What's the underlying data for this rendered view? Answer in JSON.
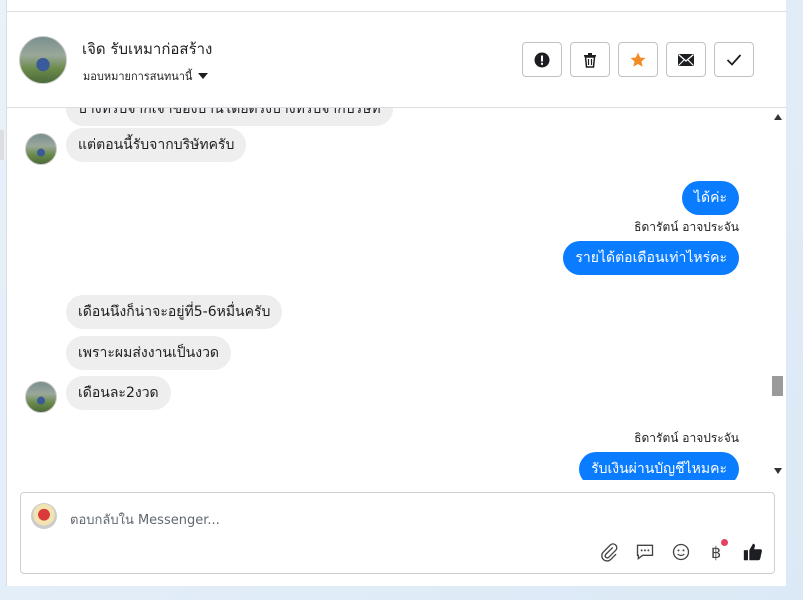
{
  "header": {
    "contact_name": "เจิด รับเหมาก่อสร้าง",
    "assign_label": "มอบหมายการสนทนานี้",
    "actions": [
      {
        "name": "report-button",
        "icon": "alert-icon"
      },
      {
        "name": "delete-button",
        "icon": "trash-icon"
      },
      {
        "name": "star-button",
        "icon": "star-icon"
      },
      {
        "name": "mail-button",
        "icon": "mail-icon"
      },
      {
        "name": "done-button",
        "icon": "check-icon"
      }
    ]
  },
  "messages": [
    {
      "side": "in",
      "text": "บางทีรับจากเจ้าของบ้านโดยตรงบางทีรับจากบริษัท",
      "avatar": false
    },
    {
      "side": "in",
      "text": "แต่ตอนนี้รับจากบริษัทครับ",
      "avatar": true
    },
    {
      "side": "out",
      "text": "ได้ค่ะ"
    },
    {
      "side": "out",
      "sender": "ธิดารัตน์ อาจประจัน",
      "text": "รายได้ต่อเดือนเท่าไหร่คะ"
    },
    {
      "side": "in",
      "text": "เดือนนึงก็น่าจะอยู่ที่5-6หมื่นครับ",
      "avatar": false
    },
    {
      "side": "in",
      "text": "เพราะผมส่งงานเป็นงวด",
      "avatar": false
    },
    {
      "side": "in",
      "text": "เดือนละ2งวด",
      "avatar": true
    },
    {
      "side": "out",
      "sender": "ธิดารัตน์ อาจประจัน",
      "text": "รับเงินผ่านบัญชีไหมคะ"
    }
  ],
  "composer": {
    "placeholder": "ตอบกลับใน Messenger...",
    "tools": [
      "paperclip-icon",
      "saved-reply-icon",
      "emoji-icon",
      "baht-icon",
      "thumbs-up-icon"
    ]
  },
  "colors": {
    "outgoing_bubble": "#0a7cff",
    "incoming_bubble": "#eeeeee",
    "star": "#f28c28"
  }
}
